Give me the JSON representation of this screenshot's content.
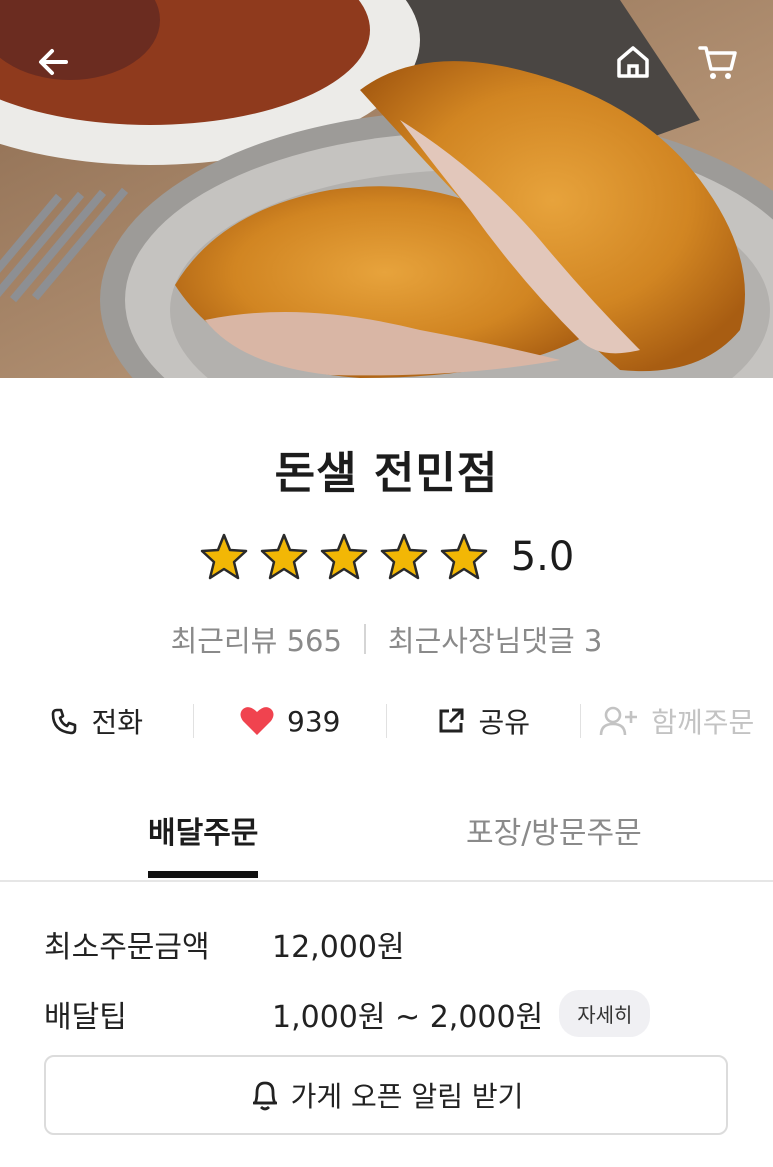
{
  "header": {
    "back_icon": "back-arrow-icon",
    "home_icon": "home-icon",
    "cart_icon": "cart-icon"
  },
  "store": {
    "name": "돈샐 전민점",
    "rating": 5.0,
    "rating_text": "5.0",
    "star_count": 5,
    "star_color": "#f2b705",
    "reviews_label": "최근리뷰 565",
    "owner_replies_label": "최근사장님댓글 3"
  },
  "actions": [
    {
      "label": "전화",
      "icon": "phone-icon",
      "enabled": true
    },
    {
      "label": "939",
      "icon": "heart-icon",
      "enabled": true,
      "color": "#f0434f"
    },
    {
      "label": "공유",
      "icon": "share-icon",
      "enabled": true
    },
    {
      "label": "함께주문",
      "icon": "add-user-icon",
      "enabled": false
    }
  ],
  "tabs": {
    "delivery": "배달주문",
    "pickup": "포장/방문주문",
    "active": "delivery"
  },
  "info": {
    "min_order_label": "최소주문금액",
    "min_order_value": "12,000원",
    "tip_label": "배달팁",
    "tip_value": "1,000원 ~ 2,000원",
    "detail_button": "자세히"
  },
  "open_alert": {
    "label": "가게 오픈 알림 받기",
    "icon": "bell-icon"
  }
}
